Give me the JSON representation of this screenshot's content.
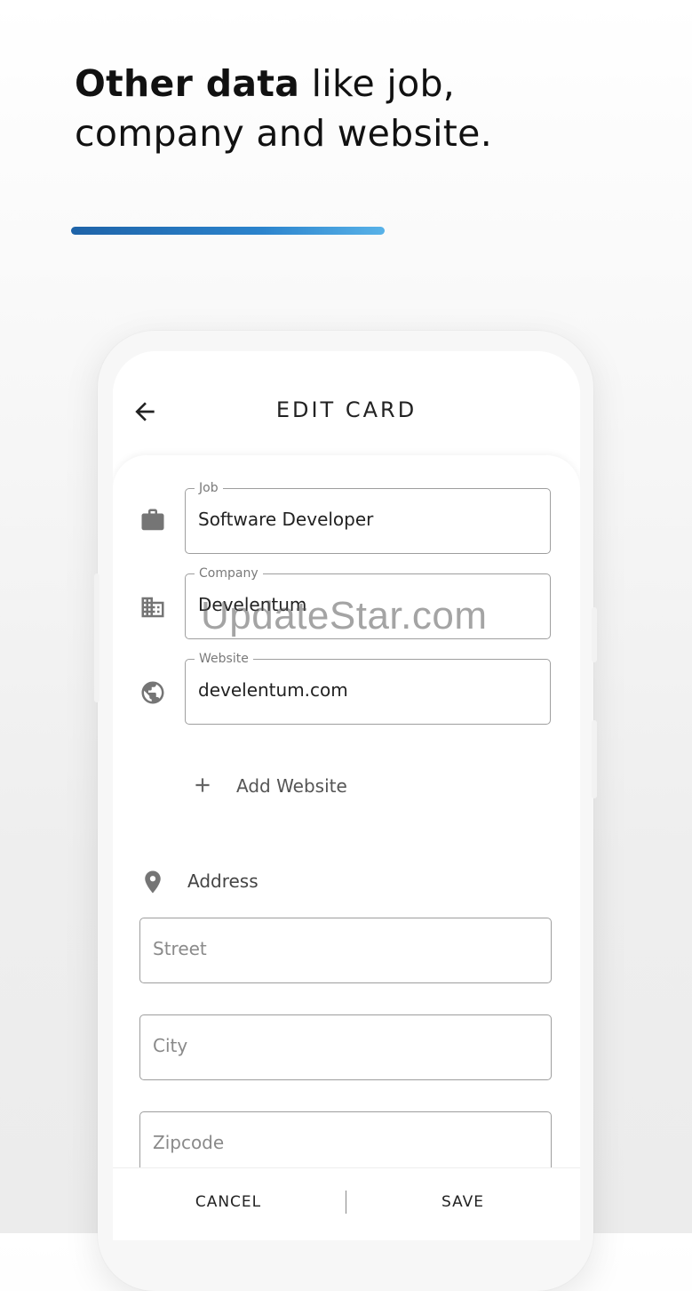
{
  "headline": {
    "bold": "Other data",
    "rest_line1": " like job,",
    "line2": "company and website."
  },
  "colors": {
    "accent_start": "#1e63a8",
    "accent_end": "#58b2e8"
  },
  "screen": {
    "title": "EDIT CARD",
    "back_icon": "arrow-left-icon"
  },
  "fields": {
    "job": {
      "label": "Job",
      "value": "Software Developer",
      "icon": "briefcase-icon"
    },
    "company": {
      "label": "Company",
      "value": "Develentum",
      "icon": "building-icon"
    },
    "website": {
      "label": "Website",
      "value": "develentum.com",
      "icon": "globe-icon"
    }
  },
  "add_website": {
    "label": "Add Website",
    "icon": "plus-icon"
  },
  "address": {
    "label": "Address",
    "icon": "location-pin-icon",
    "street_placeholder": "Street",
    "city_placeholder": "City",
    "zipcode_placeholder": "Zipcode"
  },
  "actions": {
    "cancel": "CANCEL",
    "save": "SAVE"
  },
  "watermark": "UpdateStar.com"
}
